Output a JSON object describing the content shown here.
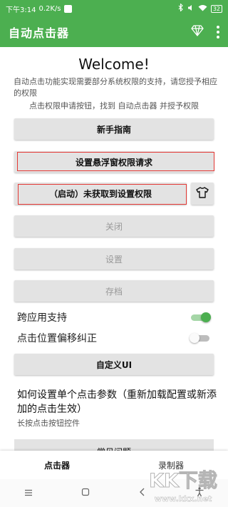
{
  "status_bar": {
    "time": "下午3:14",
    "speed": "0.2K/s",
    "battery": "32"
  },
  "app_bar": {
    "title": "自动点击器"
  },
  "welcome": {
    "heading": "Welcome!",
    "intro_line1": "自动点击功能实现需要部分系统权限的支持，请您授予相应的权限",
    "intro_line2": "点击权限申请按钮，找到 自动点击器 并授予权限"
  },
  "buttons": {
    "guide": "新手指南",
    "overlay_permission": "设置悬浮窗权限请求",
    "start": "（启动）未获取到设置权限",
    "close": "关闭",
    "settings": "设置",
    "archive": "存档",
    "custom_ui": "自定义UI"
  },
  "toggles": {
    "cross_app": {
      "label": "跨应用支持",
      "on": true
    },
    "offset_fix": {
      "label": "点击位置偏移纠正",
      "on": false
    }
  },
  "howto": {
    "title": "如何设置单个点击参数（重新加载配置或新添加的点击生效）",
    "subtitle": "长按点击按钮控件"
  },
  "faq_button": "常见问题",
  "bottom_nav": {
    "tabs": [
      "点击器",
      "录制器"
    ]
  },
  "watermark": {
    "text": "KK下载",
    "url": "www.kkx.net"
  },
  "colors": {
    "primary": "#4caf50",
    "button_bg": "#e3e3e3",
    "highlight_border": "#e53935",
    "disabled_text": "#999999"
  },
  "icons": [
    "wifi-icon",
    "bluetooth-icon",
    "diamond-icon",
    "more-vert-icon",
    "shirt-icon",
    "menu-nav-icon",
    "home-nav-icon",
    "back-nav-icon",
    "accessibility-icon"
  ]
}
